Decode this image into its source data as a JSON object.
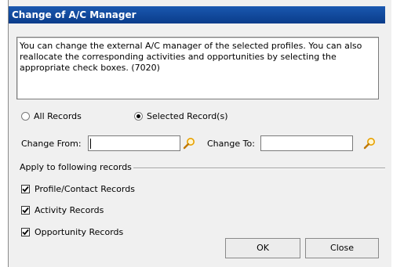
{
  "dialog": {
    "title": "Change of A/C Manager",
    "info_text": "You can change the external A/C manager of the selected profiles. You can also reallocate the corresponding activities and opportunities by selecting the appropriate check boxes. (7020)"
  },
  "scope": {
    "all_records_label": "All Records",
    "selected_records_label": "Selected Record(s)",
    "selected": "Selected Record(s)"
  },
  "change_from": {
    "label": "Change From:",
    "value": ""
  },
  "change_to": {
    "label": "Change To:",
    "value": ""
  },
  "apply_group": {
    "label": "Apply to following records",
    "items": [
      {
        "label": "Profile/Contact Records",
        "checked": true
      },
      {
        "label": "Activity Records",
        "checked": true
      },
      {
        "label": "Opportunity Records",
        "checked": true
      }
    ]
  },
  "buttons": {
    "ok_label": "OK",
    "close_label": "Close"
  },
  "colors": {
    "title_bar": "#0f4aa0",
    "dialog_bg": "#f0f0f0",
    "lookup_icon": "#e8a000"
  },
  "icons": {
    "lookup": "magnifier-icon"
  }
}
